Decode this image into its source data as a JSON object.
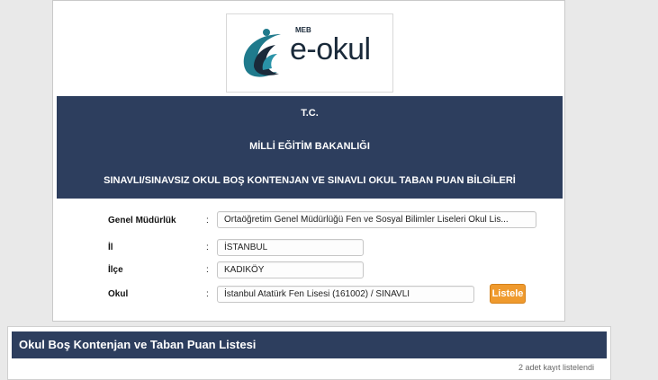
{
  "logo": {
    "brand_text": "e-okul",
    "small_text": "MEB"
  },
  "header": {
    "line1": "T.C.",
    "line2": "MİLLİ EĞİTİM BAKANLIĞI",
    "line3": "SINAVLI/SINAVSIZ OKUL BOŞ KONTENJAN VE SINAVLI OKUL TABAN PUAN BİLGİLERİ"
  },
  "form": {
    "colon": ":",
    "genel_mudurluk": {
      "label": "Genel Müdürlük",
      "value": "Ortaöğretim Genel Müdürlüğü Fen ve Sosyal Bilimler Liseleri Okul Lis..."
    },
    "il": {
      "label": "İl",
      "value": "İSTANBUL"
    },
    "ilce": {
      "label": "İlçe",
      "value": "KADIKÖY"
    },
    "okul": {
      "label": "Okul",
      "value": "İstanbul Atatürk Fen Lisesi (161002) / SINAVLI"
    },
    "list_button": "Listele"
  },
  "results": {
    "title": "Okul Boş Kontenjan ve Taban Puan Listesi",
    "count_text": "2 adet kayıt listelendi"
  },
  "colors": {
    "band": "#2d3e5e",
    "button": "#ef9a2e",
    "logo_teal": "#1f7a8c",
    "logo_dark": "#1a2a3a"
  }
}
